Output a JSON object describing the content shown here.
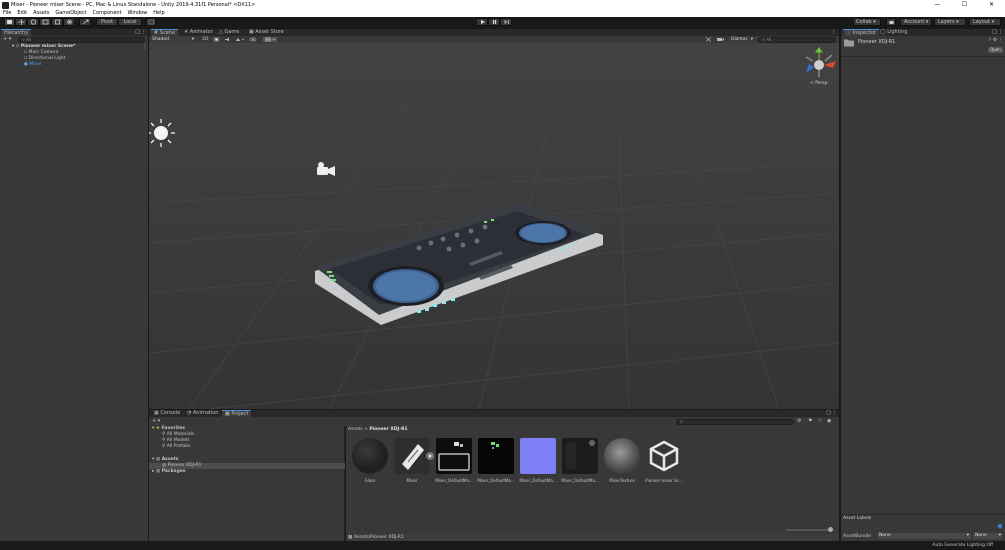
{
  "window": {
    "title": "Mixer - Pioneer mixer Scene - PC, Mac & Linux Standalone - Unity 2019.4.31f1 Personal* <DX11>",
    "minimize": "—",
    "maximize": "☐",
    "close": "✕"
  },
  "menu": [
    "File",
    "Edit",
    "Assets",
    "GameObject",
    "Component",
    "Window",
    "Help"
  ],
  "toolbar": {
    "pivot": "Pivot",
    "local": "Local",
    "collab": "Collab",
    "account": "Account",
    "layers": "Layers",
    "layout": "Layout"
  },
  "hierarchy": {
    "tab": "Hierarchy",
    "search_placeholder": "All",
    "scene": "Pioneer mixer Scene*",
    "items": [
      "Main Camera",
      "Directional Light",
      "Mixer"
    ]
  },
  "scene_tabs": [
    "Scene",
    "Animator",
    "Game",
    "Asset Store"
  ],
  "scene_toolbar": {
    "shading": "Shaded",
    "mode": "2D",
    "gizmos": "Gizmos",
    "search_placeholder": "All"
  },
  "scene": {
    "persp_label": "< Persp"
  },
  "inspector": {
    "tabs": [
      "Inspector",
      "Lighting"
    ],
    "selected": "Pioneer XDJ-R1",
    "open_button": "Open",
    "asset_labels": "Asset Labels",
    "assetbundle_label": "AssetBundle",
    "assetbundle_value": "None",
    "assetbundle_variant": "None"
  },
  "bottom_tabs": [
    "Console",
    "Animation",
    "Project"
  ],
  "project": {
    "favorites": "Favorites",
    "favorites_items": [
      "All Materials",
      "All Models",
      "All Prefabs"
    ],
    "assets": "Assets",
    "assets_children": [
      "Pioneer XDJ-R1"
    ],
    "packages": "Packages",
    "breadcrumb": [
      "Assets",
      "Pioneer XDJ-R1"
    ],
    "breadcrumb_sep": ">",
    "items": [
      {
        "label": "Glass",
        "color": "#1f1f1f"
      },
      {
        "label": "Mixer",
        "color": "#e8e8e8"
      },
      {
        "label": "Mixer_DefaultMa...",
        "color": "#0d0d0d"
      },
      {
        "label": "Mixer_DefaultMa...",
        "color": "#050505"
      },
      {
        "label": "Mixer_DefaultMa...",
        "color": "#7f7ff7"
      },
      {
        "label": "Mixer_DefaultMa...",
        "color": "#1c1c1c"
      },
      {
        "label": "MixerTexture",
        "color": "#555555"
      },
      {
        "label": "Pioneer mixer Sc...",
        "color": "#383838"
      }
    ],
    "path": "Assets/Pioneer XDJ-R1"
  },
  "status": {
    "right": "Auto Generate Lighting Off"
  },
  "colors": {
    "accent": "#4a90d9",
    "selected_item": "#3f7dc9",
    "panel": "#383838",
    "tab_bar": "#282828"
  }
}
